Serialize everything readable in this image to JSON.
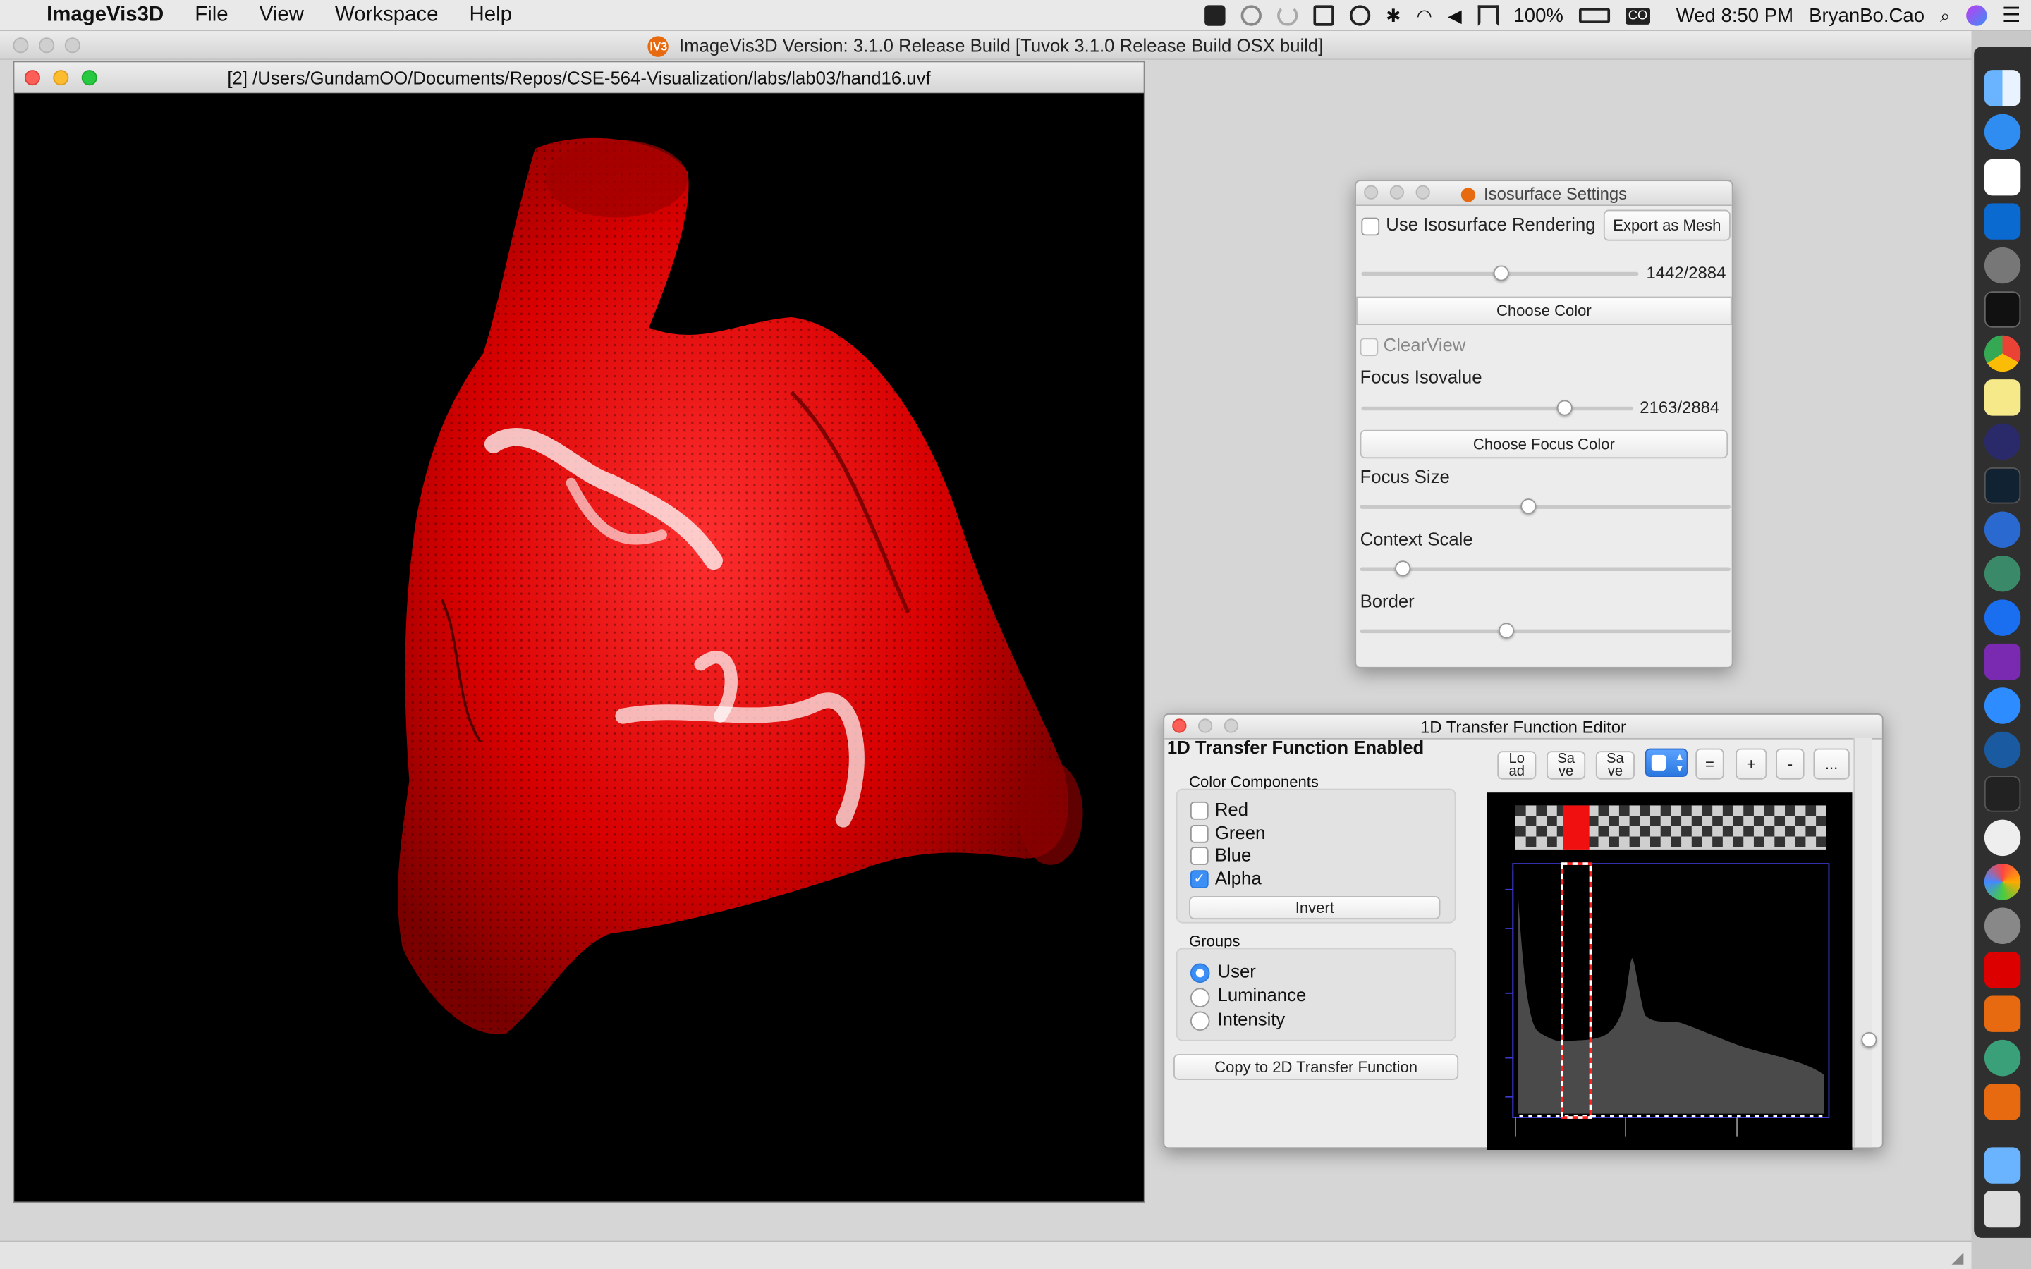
{
  "menubar": {
    "app_name": "ImageVis3D",
    "menus": [
      "File",
      "View",
      "Workspace",
      "Help"
    ],
    "battery": "100%",
    "clock": "Wed 8:50 PM",
    "user": "BryanBo.Cao",
    "input_badge": "CO"
  },
  "main_window": {
    "title": "ImageVis3D Version: 3.1.0 Release Build [Tuvok 3.1.0 Release Build OSX build]",
    "icon_text": "IV3"
  },
  "render_window": {
    "title": "[2] /Users/GundamOO/Documents/Repos/CSE-564-Visualization/labs/lab03/hand16.uvf"
  },
  "isosurface": {
    "title": "Isosurface Settings",
    "use_iso_label": "Use Isosurface Rendering",
    "use_iso_checked": false,
    "export_label": "Export as Mesh",
    "iso_value": "1442/2884",
    "iso_fraction": 0.5,
    "choose_color": "Choose Color",
    "clearview_label": "ClearView",
    "focus_iso_label": "Focus Isovalue",
    "focus_value": "2163/2884",
    "focus_fraction": 0.75,
    "choose_focus_color": "Choose Focus Color",
    "focus_size_label": "Focus Size",
    "focus_size_fraction": 0.45,
    "context_scale_label": "Context Scale",
    "context_scale_fraction": 0.12,
    "border_label": "Border",
    "border_fraction": 0.4
  },
  "tf_editor": {
    "title": "1D Transfer Function Editor",
    "enabled_label": "1D Transfer Function Enabled",
    "color_components_label": "Color Components",
    "components": [
      {
        "label": "Red",
        "checked": false
      },
      {
        "label": "Green",
        "checked": false
      },
      {
        "label": "Blue",
        "checked": false
      },
      {
        "label": "Alpha",
        "checked": true
      }
    ],
    "invert_label": "Invert",
    "groups_label": "Groups",
    "groups": [
      {
        "label": "User",
        "selected": true
      },
      {
        "label": "Luminance",
        "selected": false
      },
      {
        "label": "Intensity",
        "selected": false
      }
    ],
    "copy_label": "Copy to 2D Transfer Function",
    "toolbar": [
      "Lo\nad",
      "Sa\nve",
      "Sa\nve",
      "",
      "=",
      "+",
      "-",
      "..."
    ]
  },
  "colors": {
    "volume_red": "#e00000",
    "selection": "#ff2020",
    "accent": "#3b8ff5"
  }
}
